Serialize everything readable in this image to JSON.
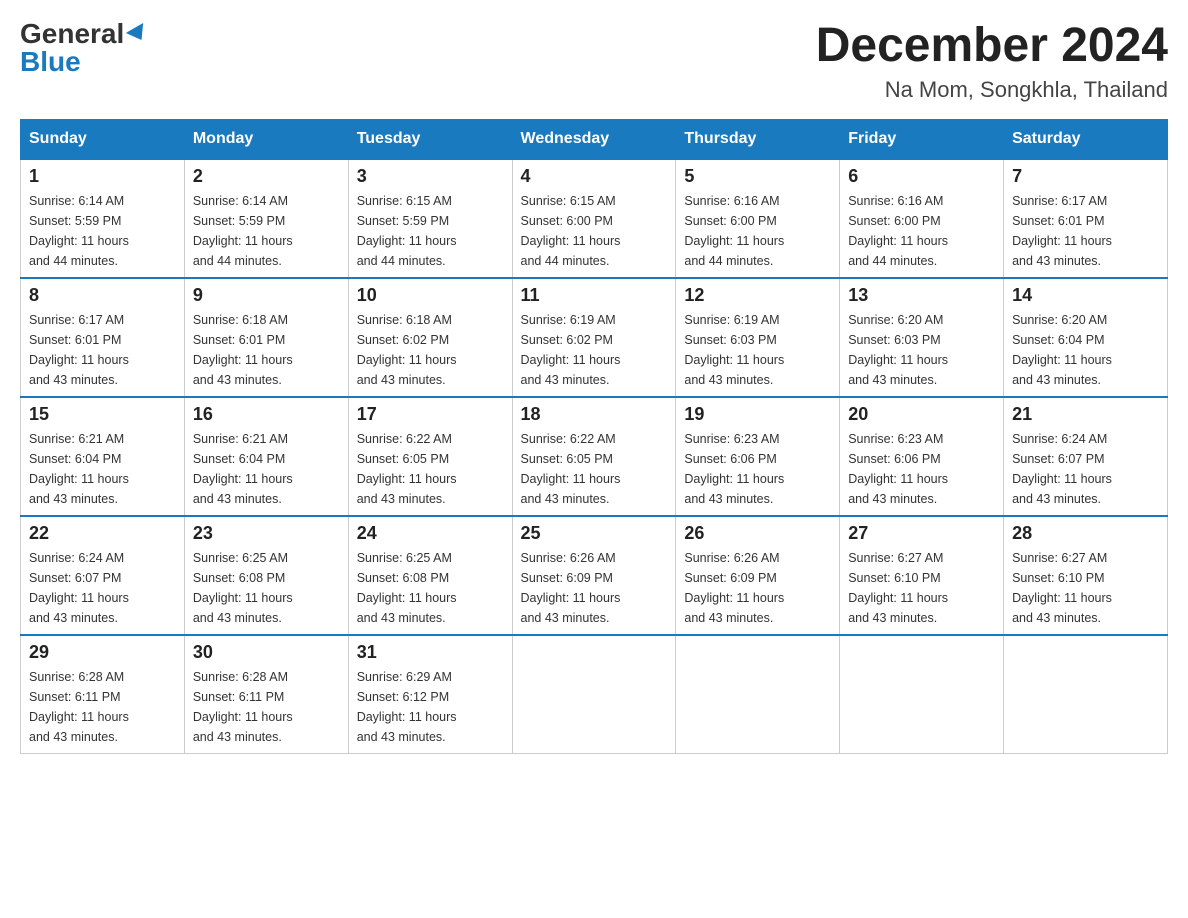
{
  "header": {
    "logo_general": "General",
    "logo_blue": "Blue",
    "month_title": "December 2024",
    "location": "Na Mom, Songkhla, Thailand"
  },
  "days_of_week": [
    "Sunday",
    "Monday",
    "Tuesday",
    "Wednesday",
    "Thursday",
    "Friday",
    "Saturday"
  ],
  "weeks": [
    [
      {
        "num": "1",
        "sunrise": "6:14 AM",
        "sunset": "5:59 PM",
        "daylight": "11 hours and 44 minutes."
      },
      {
        "num": "2",
        "sunrise": "6:14 AM",
        "sunset": "5:59 PM",
        "daylight": "11 hours and 44 minutes."
      },
      {
        "num": "3",
        "sunrise": "6:15 AM",
        "sunset": "5:59 PM",
        "daylight": "11 hours and 44 minutes."
      },
      {
        "num": "4",
        "sunrise": "6:15 AM",
        "sunset": "6:00 PM",
        "daylight": "11 hours and 44 minutes."
      },
      {
        "num": "5",
        "sunrise": "6:16 AM",
        "sunset": "6:00 PM",
        "daylight": "11 hours and 44 minutes."
      },
      {
        "num": "6",
        "sunrise": "6:16 AM",
        "sunset": "6:00 PM",
        "daylight": "11 hours and 44 minutes."
      },
      {
        "num": "7",
        "sunrise": "6:17 AM",
        "sunset": "6:01 PM",
        "daylight": "11 hours and 43 minutes."
      }
    ],
    [
      {
        "num": "8",
        "sunrise": "6:17 AM",
        "sunset": "6:01 PM",
        "daylight": "11 hours and 43 minutes."
      },
      {
        "num": "9",
        "sunrise": "6:18 AM",
        "sunset": "6:01 PM",
        "daylight": "11 hours and 43 minutes."
      },
      {
        "num": "10",
        "sunrise": "6:18 AM",
        "sunset": "6:02 PM",
        "daylight": "11 hours and 43 minutes."
      },
      {
        "num": "11",
        "sunrise": "6:19 AM",
        "sunset": "6:02 PM",
        "daylight": "11 hours and 43 minutes."
      },
      {
        "num": "12",
        "sunrise": "6:19 AM",
        "sunset": "6:03 PM",
        "daylight": "11 hours and 43 minutes."
      },
      {
        "num": "13",
        "sunrise": "6:20 AM",
        "sunset": "6:03 PM",
        "daylight": "11 hours and 43 minutes."
      },
      {
        "num": "14",
        "sunrise": "6:20 AM",
        "sunset": "6:04 PM",
        "daylight": "11 hours and 43 minutes."
      }
    ],
    [
      {
        "num": "15",
        "sunrise": "6:21 AM",
        "sunset": "6:04 PM",
        "daylight": "11 hours and 43 minutes."
      },
      {
        "num": "16",
        "sunrise": "6:21 AM",
        "sunset": "6:04 PM",
        "daylight": "11 hours and 43 minutes."
      },
      {
        "num": "17",
        "sunrise": "6:22 AM",
        "sunset": "6:05 PM",
        "daylight": "11 hours and 43 minutes."
      },
      {
        "num": "18",
        "sunrise": "6:22 AM",
        "sunset": "6:05 PM",
        "daylight": "11 hours and 43 minutes."
      },
      {
        "num": "19",
        "sunrise": "6:23 AM",
        "sunset": "6:06 PM",
        "daylight": "11 hours and 43 minutes."
      },
      {
        "num": "20",
        "sunrise": "6:23 AM",
        "sunset": "6:06 PM",
        "daylight": "11 hours and 43 minutes."
      },
      {
        "num": "21",
        "sunrise": "6:24 AM",
        "sunset": "6:07 PM",
        "daylight": "11 hours and 43 minutes."
      }
    ],
    [
      {
        "num": "22",
        "sunrise": "6:24 AM",
        "sunset": "6:07 PM",
        "daylight": "11 hours and 43 minutes."
      },
      {
        "num": "23",
        "sunrise": "6:25 AM",
        "sunset": "6:08 PM",
        "daylight": "11 hours and 43 minutes."
      },
      {
        "num": "24",
        "sunrise": "6:25 AM",
        "sunset": "6:08 PM",
        "daylight": "11 hours and 43 minutes."
      },
      {
        "num": "25",
        "sunrise": "6:26 AM",
        "sunset": "6:09 PM",
        "daylight": "11 hours and 43 minutes."
      },
      {
        "num": "26",
        "sunrise": "6:26 AM",
        "sunset": "6:09 PM",
        "daylight": "11 hours and 43 minutes."
      },
      {
        "num": "27",
        "sunrise": "6:27 AM",
        "sunset": "6:10 PM",
        "daylight": "11 hours and 43 minutes."
      },
      {
        "num": "28",
        "sunrise": "6:27 AM",
        "sunset": "6:10 PM",
        "daylight": "11 hours and 43 minutes."
      }
    ],
    [
      {
        "num": "29",
        "sunrise": "6:28 AM",
        "sunset": "6:11 PM",
        "daylight": "11 hours and 43 minutes."
      },
      {
        "num": "30",
        "sunrise": "6:28 AM",
        "sunset": "6:11 PM",
        "daylight": "11 hours and 43 minutes."
      },
      {
        "num": "31",
        "sunrise": "6:29 AM",
        "sunset": "6:12 PM",
        "daylight": "11 hours and 43 minutes."
      },
      null,
      null,
      null,
      null
    ]
  ],
  "labels": {
    "sunrise": "Sunrise:",
    "sunset": "Sunset:",
    "daylight": "Daylight:"
  }
}
